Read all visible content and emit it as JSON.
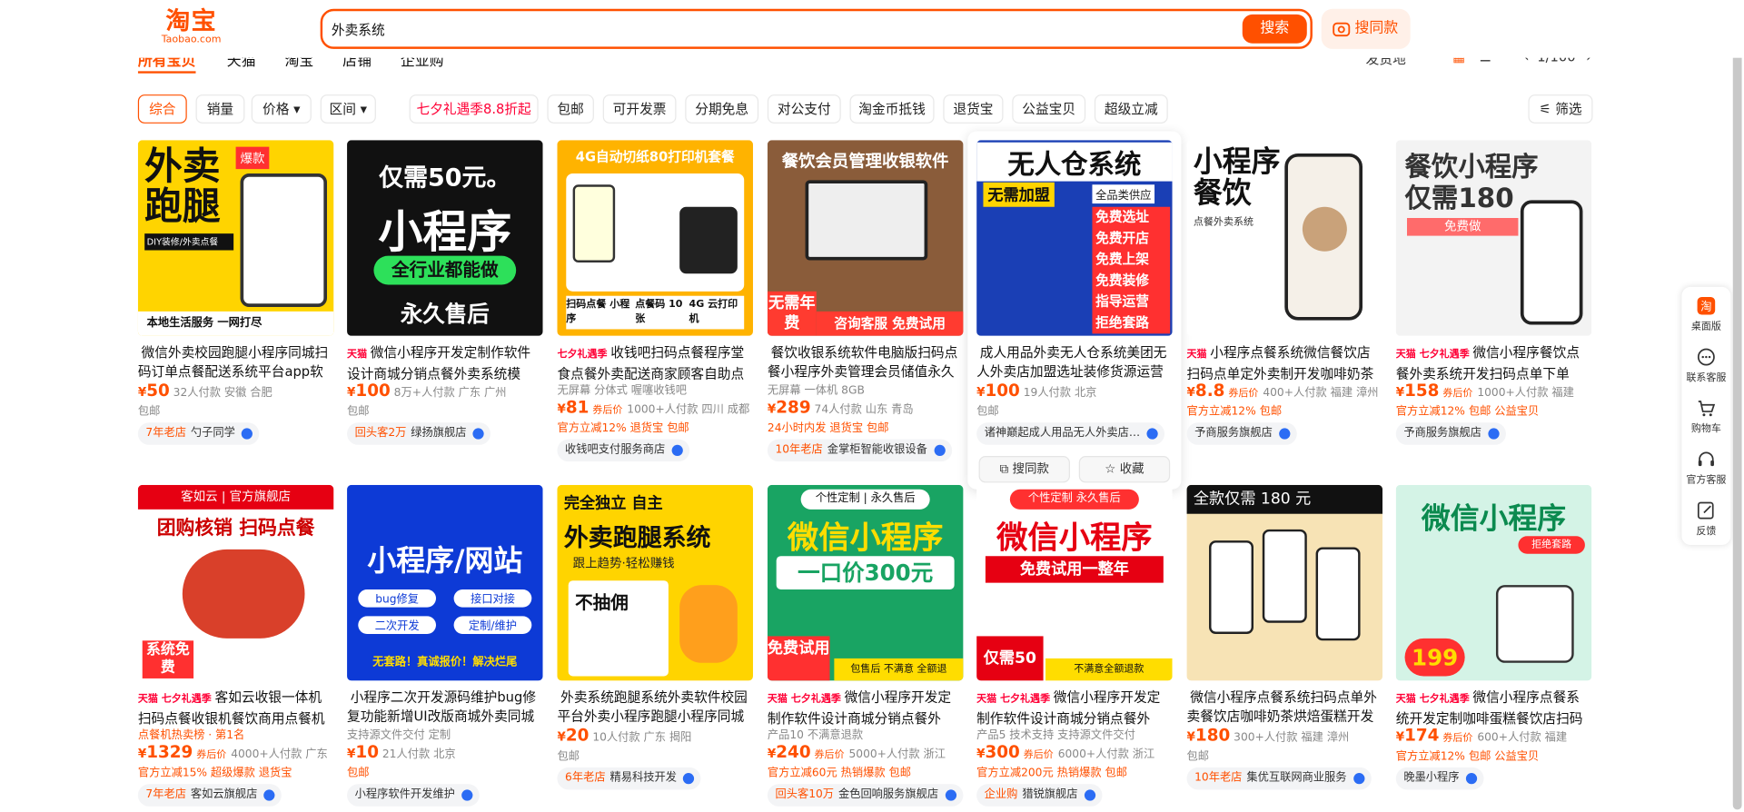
{
  "logo": {
    "cn": "淘宝",
    "en": "Taobao.com"
  },
  "search": {
    "value": "外卖系统",
    "button": "搜索",
    "image_search": "搜同款"
  },
  "tabs": {
    "all": "所有宝贝",
    "tmall": "天猫",
    "taobao": "淘宝",
    "store": "店铺",
    "enterprise": "企业购",
    "ship_from": "发货地",
    "page": "1/100"
  },
  "filters": {
    "comprehensive": "综合",
    "sales": "销量",
    "price": "价格",
    "range": "区间",
    "promo": "七夕礼遇季8.8折起",
    "free_ship": "包邮",
    "invoice": "可开发票",
    "installment": "分期免息",
    "corp_pay": "对公支付",
    "coins": "淘金币抵钱",
    "return_ins": "退货宝",
    "charity": "公益宝贝",
    "super_cut": "超级立减",
    "more": "筛选"
  },
  "hover": {
    "same": "搜同款",
    "fav": "收藏"
  },
  "sidebar": {
    "desktop": "桌面版",
    "contact": "联系客服",
    "cart": "购物车",
    "service": "官方客服",
    "feedback": "反馈"
  },
  "colors": {
    "accent": "#ff5000",
    "tmall": "#ff0036"
  },
  "products": [
    {
      "title": "微信外卖校园跑腿小程序同城扫码订单点餐配送系统平台app软件",
      "tag": "",
      "price": "50",
      "sub": "32人付款  安徽 合肥",
      "extra": "包邮",
      "promo": "",
      "shop": "勺子同学",
      "shop_prefix": "7年老店",
      "img": [
        "外卖",
        "跑腿",
        "爆款",
        "DIY装修/外卖点餐",
        "本地生活服务  一网打尽"
      ]
    },
    {
      "title": "微信小程序开发定制作软件设计商城分销点餐外卖系统模板…",
      "tag": "天猫",
      "price": "100",
      "sub": "8万+人付款  广东 广州",
      "extra": "包邮",
      "promo": "",
      "shop": "绿扬旗舰店",
      "shop_prefix": "回头客2万",
      "img": [
        "仅需50元。",
        "小程序",
        "全行业都能做",
        "永久售后"
      ]
    },
    {
      "title": "收钱吧扫码点餐程序堂食点餐外卖配送商家顾客自助点餐…",
      "tag": "七夕礼遇季",
      "price": "81",
      "sub": "1000+人付款  四川 成都",
      "extra": "无屏幕  分体式  喔噻收钱吧",
      "promo": "官方立减12%  退货宝  包邮",
      "shop": "收钱吧支付服务商店",
      "shop_prefix": "",
      "img": [
        "4G自动切纸80打印机套餐",
        "扫码点餐 小程序",
        "点餐码 10张",
        "4G 云打印机"
      ]
    },
    {
      "title": "餐饮收银系统软件电脑版扫码点餐小程序外卖管理会员储值永久授权",
      "tag": "",
      "price": "289",
      "sub": "74人付款  山东 青岛",
      "extra": "无屏幕  一体机  8GB",
      "promo": "24小时内发  退货宝  包邮",
      "shop": "金掌柜智能收银设备",
      "shop_prefix": "10年老店",
      "img": [
        "餐饮会员管理收银软件",
        "无需年费",
        "咨询客服 免费试用"
      ]
    },
    {
      "title": "成人用品外卖无人仓系统美团无人外卖店加盟选址装修货源运营服务",
      "tag": "",
      "price": "100",
      "sub": "19人付款  北京",
      "extra": "包邮",
      "promo": "",
      "shop": "诸神巅起成人用品无人外卖店…",
      "shop_prefix": "",
      "img": [
        "无人仓系统",
        "无需加盟",
        "全品类供应",
        "免费选址",
        "免费开店",
        "免费上架",
        "免费装修",
        "指导运营",
        "拒绝套路"
      ]
    },
    {
      "title": "小程序点餐系统微信餐饮店扫码点单定外卖制开发咖啡奶茶烘…",
      "tag": "天猫",
      "price": "8.8",
      "sub": "400+人付款  福建 漳州",
      "extra": "",
      "promo": "官方立减12%  包邮",
      "shop": "予商服务旗舰店",
      "shop_prefix": "",
      "img": [
        "小程序",
        "餐饮",
        "点餐外卖系统"
      ]
    },
    {
      "title": "微信小程序餐饮点餐外卖系统开发扫码点单下单商…",
      "tag": "天猫 七夕礼遇季",
      "price": "158",
      "sub": "1000+人付款  福建",
      "extra": "",
      "promo": "官方立减12%  包邮  公益宝贝",
      "shop": "予商服务旗舰店",
      "shop_prefix": "",
      "img": [
        "餐饮小程序",
        "仅需180",
        "免费做"
      ]
    },
    {
      "title": "客如云收银一体机扫码点餐收银机餐饮商用点餐机 收…",
      "tag": "天猫 七夕礼遇季",
      "price": "1329",
      "sub": "4000+人付款  广东",
      "extra": "点餐机热卖榜 · 第1名",
      "promo": "官方立减15%  超级爆款  退货宝",
      "shop": "客如云旗舰店",
      "shop_prefix": "7年老店",
      "img": [
        "客如云 | 官方旗舰店",
        "团购核销 扫码点餐",
        "系统免费"
      ]
    },
    {
      "title": "小程序二次开发源码维护bug修复功能新增UI改版商城外卖同城系统",
      "tag": "",
      "price": "10",
      "sub": "21人付款  北京",
      "extra": "支持源文件交付  定制",
      "promo": "包邮",
      "shop": "小程序软件开发维护",
      "shop_prefix": "",
      "img": [
        "小程序/网站",
        "bug修复",
        "接口对接",
        "二次开发",
        "定制/维护",
        "无套路！真诚报价！解决烂尾"
      ]
    },
    {
      "title": "外卖系统跑腿系统外卖软件校园平台外卖小程序跑腿小程序同城配送",
      "tag": "",
      "price": "20",
      "sub": "10人付款  广东 揭阳",
      "extra": "包邮",
      "promo": "",
      "shop": "精易科技开发",
      "shop_prefix": "6年老店",
      "img": [
        "完全独立 自主",
        "外卖跑腿系统",
        "跟上趋势·轻松赚钱",
        "不抽佣"
      ]
    },
    {
      "title": "微信小程序开发定制作软件设计商城分销点餐外卖…",
      "tag": "天猫 七夕礼遇季",
      "price": "240",
      "sub": "5000+人付款  浙江",
      "extra": "产品10  不满意退款",
      "promo": "官方立减60元  热销爆款  包邮",
      "shop": "金色回响服务旗舰店",
      "shop_prefix": "回头客10万",
      "img": [
        "个性定制 | 永久售后",
        "微信小程序",
        "一口价300元",
        "免费试用",
        "包售后 不满意 全额退"
      ]
    },
    {
      "title": "微信小程序开发定制作软件设计商城分销点餐外卖…",
      "tag": "天猫 七夕礼遇季",
      "price": "300",
      "sub": "6000+人付款  浙江",
      "extra": "产品5  技术支持  支持源文件交付",
      "promo": "官方立减200元  热销爆款  包邮",
      "shop": "猎锐旗舰店",
      "shop_prefix": "企业购",
      "img": [
        "个性定制 永久售后",
        "微信小程序",
        "免费试用一整年",
        "仅需50元",
        "不满意全额退款"
      ]
    },
    {
      "title": "微信小程序点餐系统扫码点单外卖餐饮店咖啡奶茶烘焙蛋糕开发定制",
      "tag": "",
      "price": "180",
      "sub": "300+人付款  福建 漳州",
      "extra": "包邮",
      "promo": "",
      "shop": "集优互联网商业服务",
      "shop_prefix": "10年老店",
      "img": [
        "全款仅需 180 元"
      ]
    },
    {
      "title": "微信小程序点餐系统开发定制咖啡蛋糕餐饮店扫码点单收…",
      "tag": "天猫 七夕礼遇季",
      "price": "174",
      "sub": "600+人付款  福建",
      "extra": "",
      "promo": "官方立减12%  包邮  公益宝贝",
      "shop": "晚墨小程序",
      "shop_prefix": "",
      "img": [
        "微信小程序",
        "拒绝套路",
        "199"
      ]
    }
  ]
}
